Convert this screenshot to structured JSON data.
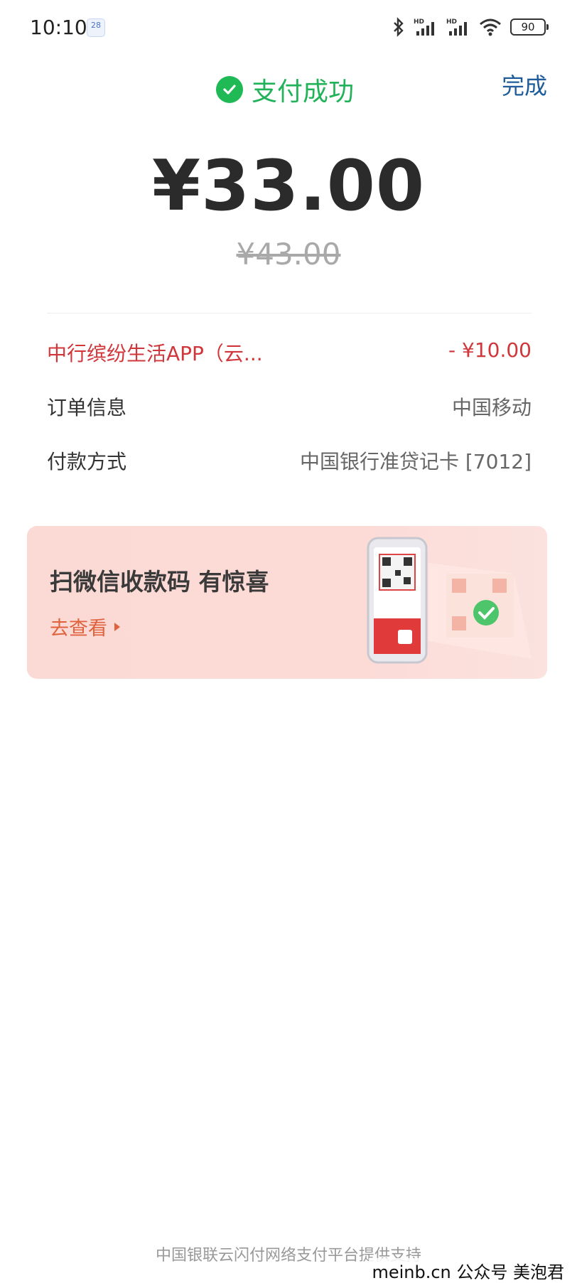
{
  "status_bar": {
    "time": "10:10",
    "calendar_day": "28",
    "battery": "90"
  },
  "header": {
    "title": "支付成功",
    "done_label": "完成",
    "success_color": "#1fb955"
  },
  "payment": {
    "amount": "¥33.00",
    "original_amount": "¥43.00"
  },
  "details": {
    "discount": {
      "label": "中行缤纷生活APP（云...",
      "value": "- ¥10.00"
    },
    "order": {
      "label": "订单信息",
      "value": "中国移动"
    },
    "method": {
      "label": "付款方式",
      "value": "中国银行准贷记卡 [7012]"
    }
  },
  "banner": {
    "title": "扫微信收款码 有惊喜",
    "link": "去查看"
  },
  "footer": {
    "text": "中国银联云闪付网络支付平台提供支持",
    "watermark": "meinb.cn  公众号 美泡君"
  },
  "colors": {
    "accent_red": "#d0363a",
    "link_blue": "#1f5c9a",
    "banner_bg": "#fcdad6"
  }
}
